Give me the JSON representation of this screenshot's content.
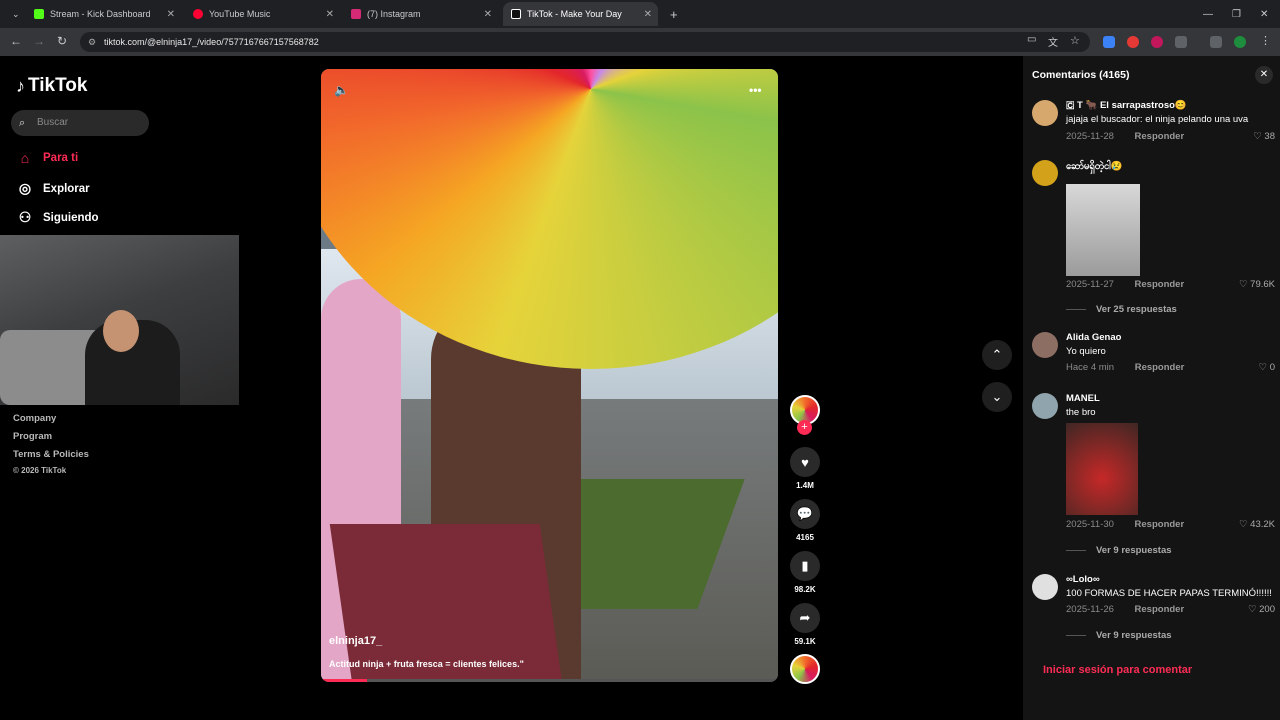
{
  "browser": {
    "tabs": [
      {
        "title": "Stream - Kick Dashboard",
        "color": "#53fc18"
      },
      {
        "title": "YouTube Music",
        "color": "#ff0033"
      },
      {
        "title": "(7) Instagram",
        "color": "#d62976"
      },
      {
        "title": "TikTok - Make Your Day",
        "color": "#ffffff"
      }
    ],
    "url": "tiktok.com/@elninja17_/video/7577167667157568782"
  },
  "sidebar": {
    "brand": "TikTok",
    "search_placeholder": "Buscar",
    "nav": [
      {
        "label": "Para ti",
        "icon": "home-icon",
        "active": true
      },
      {
        "label": "Explorar",
        "icon": "compass-icon",
        "active": false
      },
      {
        "label": "Siguiendo",
        "icon": "following-icon",
        "active": false
      }
    ],
    "footer": [
      "Company",
      "Program",
      "Terms & Policies",
      "© 2026 TikTok"
    ]
  },
  "video": {
    "username": "elninja17_",
    "caption": "Actitud ninja + fruta fresca = clientes felices.\"",
    "progress": 0.1,
    "actions": {
      "likes": "1.4M",
      "comments": "4165",
      "saves": "98.2K",
      "shares": "59.1K"
    }
  },
  "comments": {
    "title": "Comentarios (4165)",
    "items": [
      {
        "name": "🇨 T 🐂 El sarrapastroso😊",
        "text": "jajaja el buscador: el ninja pelando una uva",
        "date": "2025-11-28",
        "reply": "Responder",
        "likes": "38"
      },
      {
        "name": "ဆော်မရှိတဲ့ငါ😢",
        "text": "",
        "date": "2025-11-27",
        "reply": "Responder",
        "likes": "79.6K",
        "more": "Ver 25 respuestas"
      },
      {
        "name": "Alida Genao",
        "text": "Yo quiero",
        "date": "Hace 4 min",
        "reply": "Responder",
        "likes": "0"
      },
      {
        "name": "MANEL",
        "text": "the bro",
        "date": "2025-11-30",
        "reply": "Responder",
        "likes": "43.2K",
        "more": "Ver 9 respuestas"
      },
      {
        "name": "∞Lolo∞",
        "text": "100 FORMAS DE HACER PAPAS TERMINÓ!!!!!!",
        "date": "2025-11-26",
        "reply": "Responder",
        "likes": "200",
        "more": "Ver 9 respuestas"
      }
    ],
    "login_prompt": "Iniciar sesión para comentar"
  },
  "colors": {
    "accent": "#fe2c55"
  }
}
